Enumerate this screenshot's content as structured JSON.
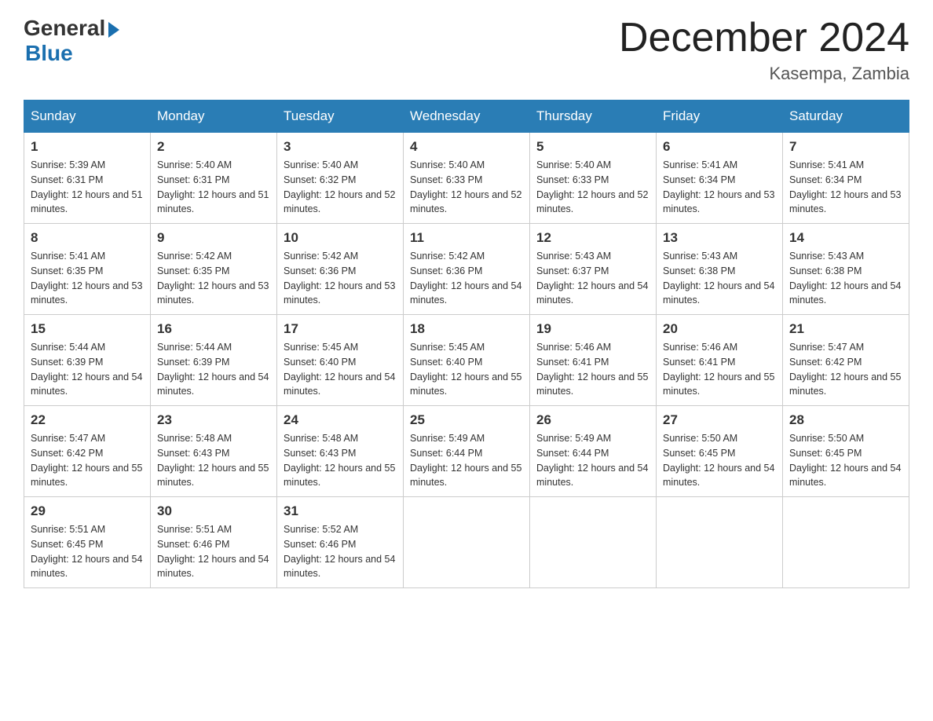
{
  "logo": {
    "general": "General",
    "blue": "Blue"
  },
  "title": "December 2024",
  "location": "Kasempa, Zambia",
  "days_of_week": [
    "Sunday",
    "Monday",
    "Tuesday",
    "Wednesday",
    "Thursday",
    "Friday",
    "Saturday"
  ],
  "weeks": [
    [
      {
        "num": "1",
        "sunrise": "5:39 AM",
        "sunset": "6:31 PM",
        "daylight": "12 hours and 51 minutes."
      },
      {
        "num": "2",
        "sunrise": "5:40 AM",
        "sunset": "6:31 PM",
        "daylight": "12 hours and 51 minutes."
      },
      {
        "num": "3",
        "sunrise": "5:40 AM",
        "sunset": "6:32 PM",
        "daylight": "12 hours and 52 minutes."
      },
      {
        "num": "4",
        "sunrise": "5:40 AM",
        "sunset": "6:33 PM",
        "daylight": "12 hours and 52 minutes."
      },
      {
        "num": "5",
        "sunrise": "5:40 AM",
        "sunset": "6:33 PM",
        "daylight": "12 hours and 52 minutes."
      },
      {
        "num": "6",
        "sunrise": "5:41 AM",
        "sunset": "6:34 PM",
        "daylight": "12 hours and 53 minutes."
      },
      {
        "num": "7",
        "sunrise": "5:41 AM",
        "sunset": "6:34 PM",
        "daylight": "12 hours and 53 minutes."
      }
    ],
    [
      {
        "num": "8",
        "sunrise": "5:41 AM",
        "sunset": "6:35 PM",
        "daylight": "12 hours and 53 minutes."
      },
      {
        "num": "9",
        "sunrise": "5:42 AM",
        "sunset": "6:35 PM",
        "daylight": "12 hours and 53 minutes."
      },
      {
        "num": "10",
        "sunrise": "5:42 AM",
        "sunset": "6:36 PM",
        "daylight": "12 hours and 53 minutes."
      },
      {
        "num": "11",
        "sunrise": "5:42 AM",
        "sunset": "6:36 PM",
        "daylight": "12 hours and 54 minutes."
      },
      {
        "num": "12",
        "sunrise": "5:43 AM",
        "sunset": "6:37 PM",
        "daylight": "12 hours and 54 minutes."
      },
      {
        "num": "13",
        "sunrise": "5:43 AM",
        "sunset": "6:38 PM",
        "daylight": "12 hours and 54 minutes."
      },
      {
        "num": "14",
        "sunrise": "5:43 AM",
        "sunset": "6:38 PM",
        "daylight": "12 hours and 54 minutes."
      }
    ],
    [
      {
        "num": "15",
        "sunrise": "5:44 AM",
        "sunset": "6:39 PM",
        "daylight": "12 hours and 54 minutes."
      },
      {
        "num": "16",
        "sunrise": "5:44 AM",
        "sunset": "6:39 PM",
        "daylight": "12 hours and 54 minutes."
      },
      {
        "num": "17",
        "sunrise": "5:45 AM",
        "sunset": "6:40 PM",
        "daylight": "12 hours and 54 minutes."
      },
      {
        "num": "18",
        "sunrise": "5:45 AM",
        "sunset": "6:40 PM",
        "daylight": "12 hours and 55 minutes."
      },
      {
        "num": "19",
        "sunrise": "5:46 AM",
        "sunset": "6:41 PM",
        "daylight": "12 hours and 55 minutes."
      },
      {
        "num": "20",
        "sunrise": "5:46 AM",
        "sunset": "6:41 PM",
        "daylight": "12 hours and 55 minutes."
      },
      {
        "num": "21",
        "sunrise": "5:47 AM",
        "sunset": "6:42 PM",
        "daylight": "12 hours and 55 minutes."
      }
    ],
    [
      {
        "num": "22",
        "sunrise": "5:47 AM",
        "sunset": "6:42 PM",
        "daylight": "12 hours and 55 minutes."
      },
      {
        "num": "23",
        "sunrise": "5:48 AM",
        "sunset": "6:43 PM",
        "daylight": "12 hours and 55 minutes."
      },
      {
        "num": "24",
        "sunrise": "5:48 AM",
        "sunset": "6:43 PM",
        "daylight": "12 hours and 55 minutes."
      },
      {
        "num": "25",
        "sunrise": "5:49 AM",
        "sunset": "6:44 PM",
        "daylight": "12 hours and 55 minutes."
      },
      {
        "num": "26",
        "sunrise": "5:49 AM",
        "sunset": "6:44 PM",
        "daylight": "12 hours and 54 minutes."
      },
      {
        "num": "27",
        "sunrise": "5:50 AM",
        "sunset": "6:45 PM",
        "daylight": "12 hours and 54 minutes."
      },
      {
        "num": "28",
        "sunrise": "5:50 AM",
        "sunset": "6:45 PM",
        "daylight": "12 hours and 54 minutes."
      }
    ],
    [
      {
        "num": "29",
        "sunrise": "5:51 AM",
        "sunset": "6:45 PM",
        "daylight": "12 hours and 54 minutes."
      },
      {
        "num": "30",
        "sunrise": "5:51 AM",
        "sunset": "6:46 PM",
        "daylight": "12 hours and 54 minutes."
      },
      {
        "num": "31",
        "sunrise": "5:52 AM",
        "sunset": "6:46 PM",
        "daylight": "12 hours and 54 minutes."
      },
      null,
      null,
      null,
      null
    ]
  ]
}
